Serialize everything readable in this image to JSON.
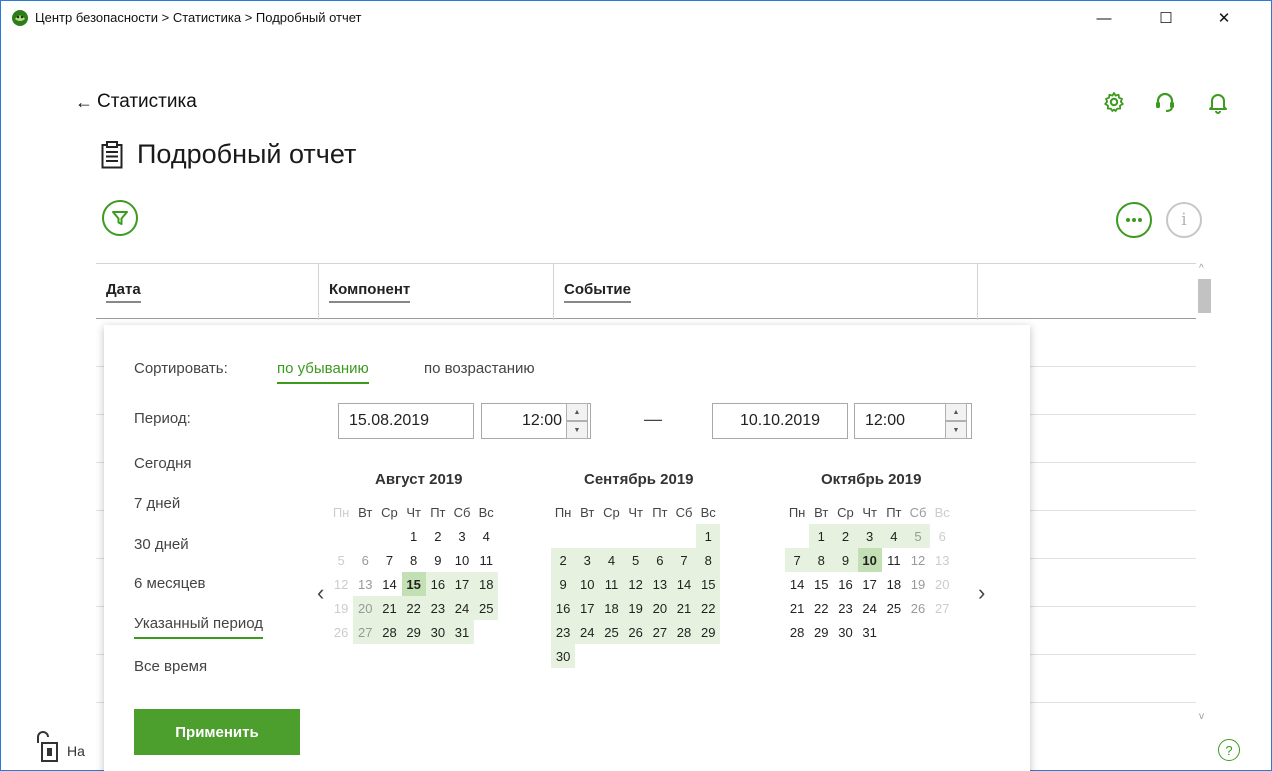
{
  "window": {
    "title": "Центр безопасности > Статистика > Подробный отчет",
    "minimize_glyph": "—",
    "maximize_glyph": "☐",
    "close_glyph": "✕"
  },
  "header": {
    "back_label": "Статистика",
    "page_title": "Подробный отчет",
    "icons": [
      "settings-icon",
      "support-icon",
      "notifications-icon"
    ]
  },
  "table": {
    "columns": [
      "Дата",
      "Компонент",
      "Событие"
    ]
  },
  "popup": {
    "sort_label": "Сортировать:",
    "sort_desc": "по убыванию",
    "sort_asc": "по возрастанию",
    "period_label": "Период:",
    "periods": [
      "Сегодня",
      "7 дней",
      "30 дней",
      "6 месяцев",
      "Указанный период",
      "Все время"
    ],
    "selected_period": "Указанный период",
    "from_date": "15.08.2019",
    "from_time": "12:00",
    "dash": "—",
    "to_date": "10.10.2019",
    "to_time": "12:00",
    "apply_label": "Применить",
    "calendars": [
      {
        "title": "Август 2019"
      },
      {
        "title": "Сентябрь 2019"
      },
      {
        "title": "Октябрь 2019"
      }
    ],
    "weekdays": [
      "Пн",
      "Вт",
      "Ср",
      "Чт",
      "Пт",
      "Сб",
      "Вс"
    ]
  },
  "footer": {
    "text": "На"
  },
  "colors": {
    "accent": "#3c9a1e",
    "apply_button": "#4c9e2d",
    "range_fill": "#e6f2df",
    "selected_fill": "#c3dfb4"
  }
}
